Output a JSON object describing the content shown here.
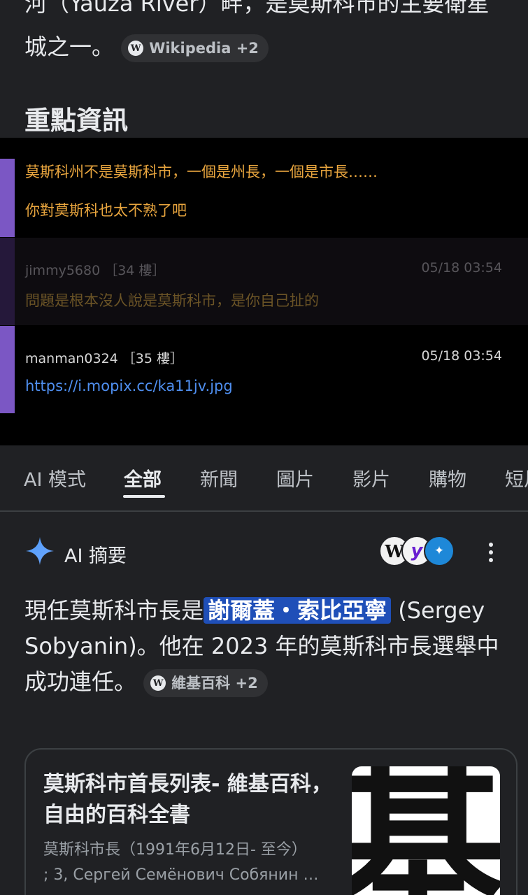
{
  "top_panel": {
    "line1": "河（Yauza River）畔，是莫斯科市的主要衛星",
    "line2": "城之一。",
    "source_chip": {
      "icon": "wikipedia-icon",
      "label": "Wikipedia +2"
    },
    "section_title": "重點資訊"
  },
  "comments": [
    {
      "quote_line1": "莫斯科州不是莫斯科市，一個是州長，一個是市長……",
      "quote_line2": "你對莫斯科也太不熟了吧"
    },
    {
      "user": "jimmy5680",
      "floor": "［34 樓］",
      "time": "05/18 03:54",
      "text": "問題是根本沒人說是莫斯科市，是你自己扯的"
    },
    {
      "user": "manman0324",
      "floor": "［35 樓］",
      "time": "05/18 03:54",
      "link": "https://i.mopix.cc/ka11jv.jpg"
    }
  ],
  "tabs": [
    "AI 模式",
    "全部",
    "新聞",
    "圖片",
    "影片",
    "購物",
    "短片"
  ],
  "active_tab": "全部",
  "ai_overview": {
    "title": "AI 摘要",
    "text_before": "現任莫斯科市長是",
    "highlight": "謝爾蓋・索比亞寧",
    "text_after": " (Sergey Sobyanin)。他在 2023 年的莫斯科市長選舉中成功連任。",
    "source_chip": {
      "icon": "wikipedia-icon",
      "label": "維基百科 +2"
    },
    "source_icons": [
      "wikipedia-icon",
      "yahoo-icon",
      "blue-source-icon"
    ]
  },
  "result_card": {
    "title": "莫斯科市首長列表- 維基百科，自由的百科全書",
    "snippet_line1": "莫斯科市長（1991年6月12日- 至今）",
    "snippet_line2": "; 3, Сергей Семёнович Собянин …",
    "thumbnail_glyph": "基"
  },
  "colors": {
    "background": "#202124",
    "comment_background": "#000000",
    "comment_accent": "#7b57c4",
    "quote_text": "#e8a53e",
    "link": "#4f8ff0",
    "highlight": "#1f4fb8"
  }
}
